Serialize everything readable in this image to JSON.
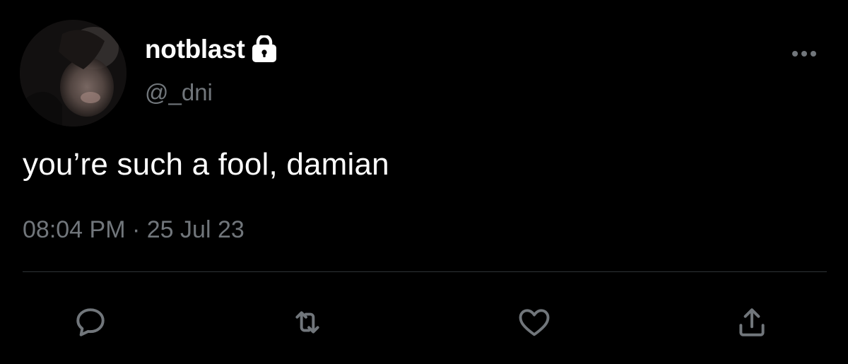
{
  "author": {
    "display_name": "notblast",
    "handle": "@_dni",
    "protected_icon": "lock-icon",
    "avatar": "profile-photo"
  },
  "tweet": {
    "text": "you’re such a fool, damian",
    "time": "08:04 PM",
    "separator": "·",
    "date": "25 Jul 23"
  },
  "actions": [
    {
      "name": "reply",
      "icon": "comment-icon"
    },
    {
      "name": "retweet",
      "icon": "retweet-icon"
    },
    {
      "name": "like",
      "icon": "heart-icon"
    },
    {
      "name": "share",
      "icon": "share-icon"
    }
  ],
  "colors": {
    "background": "#000000",
    "primary_text": "#ffffff",
    "secondary_text": "#71767b",
    "divider": "#2f3336"
  }
}
